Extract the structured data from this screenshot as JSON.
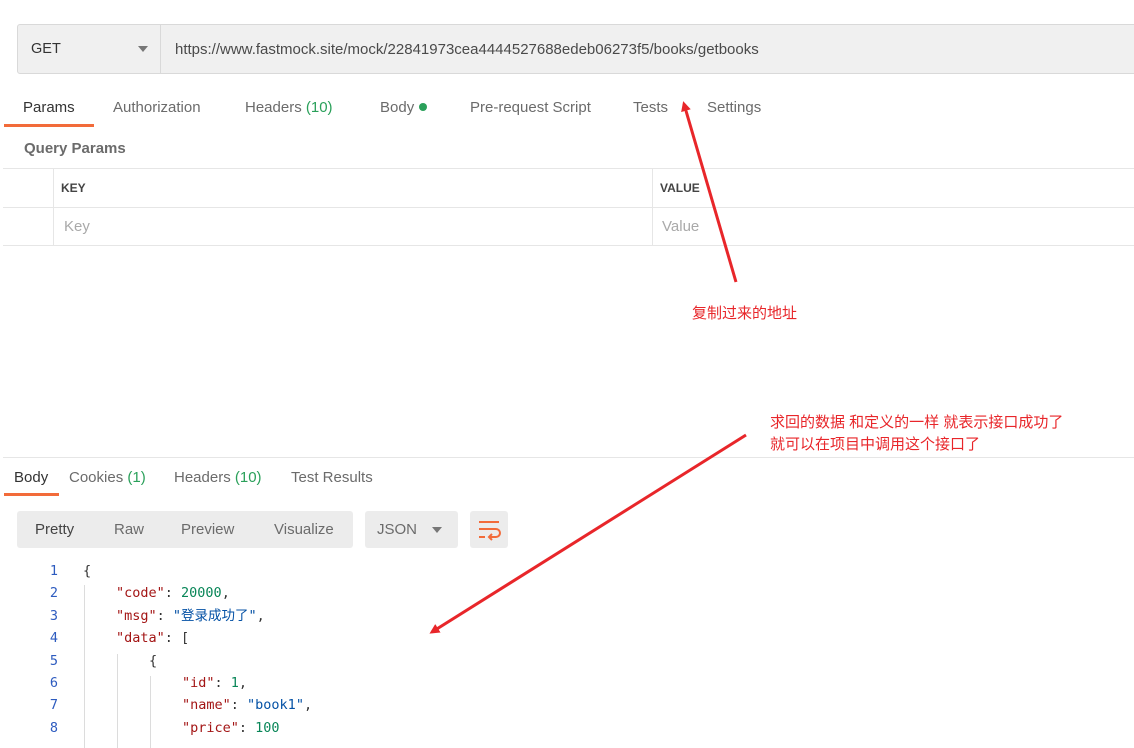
{
  "request": {
    "method": "GET",
    "url": "https://www.fastmock.site/mock/22841973cea4444527688edeb06273f5/books/getbooks"
  },
  "request_tabs": [
    {
      "label": "Params",
      "count": ""
    },
    {
      "label": "Authorization",
      "count": ""
    },
    {
      "label": "Headers",
      "count": "(10)"
    },
    {
      "label": "Body",
      "count": ""
    },
    {
      "label": "Pre-request Script",
      "count": ""
    },
    {
      "label": "Tests",
      "count": ""
    },
    {
      "label": "Settings",
      "count": ""
    }
  ],
  "query_params": {
    "title": "Query Params",
    "columns": [
      "KEY",
      "VALUE"
    ],
    "key_placeholder": "Key",
    "value_placeholder": "Value"
  },
  "annotations": {
    "address_note": "复制过来的地址",
    "response_note_line1": "求回的数据  和定义的一样  就表示接口成功了",
    "response_note_line2": "就可以在项目中调用这个接口了"
  },
  "response_tabs": [
    {
      "label": "Body",
      "count": ""
    },
    {
      "label": "Cookies",
      "count": "(1)"
    },
    {
      "label": "Headers",
      "count": "(10)"
    },
    {
      "label": "Test Results",
      "count": ""
    }
  ],
  "view_modes": [
    "Pretty",
    "Raw",
    "Preview",
    "Visualize"
  ],
  "format_select": "JSON",
  "code_lines": [
    {
      "n": "1",
      "indent": 0,
      "parts": [
        {
          "t": "p",
          "v": "{"
        }
      ]
    },
    {
      "n": "2",
      "indent": 1,
      "parts": [
        {
          "t": "k",
          "v": "\"code\""
        },
        {
          "t": "p",
          "v": ": "
        },
        {
          "t": "n",
          "v": "20000"
        },
        {
          "t": "p",
          "v": ","
        }
      ]
    },
    {
      "n": "3",
      "indent": 1,
      "parts": [
        {
          "t": "k",
          "v": "\"msg\""
        },
        {
          "t": "p",
          "v": ": "
        },
        {
          "t": "s",
          "v": "\"登录成功了\""
        },
        {
          "t": "p",
          "v": ","
        }
      ]
    },
    {
      "n": "4",
      "indent": 1,
      "parts": [
        {
          "t": "k",
          "v": "\"data\""
        },
        {
          "t": "p",
          "v": ": ["
        }
      ]
    },
    {
      "n": "5",
      "indent": 2,
      "parts": [
        {
          "t": "p",
          "v": "{"
        }
      ]
    },
    {
      "n": "6",
      "indent": 3,
      "parts": [
        {
          "t": "k",
          "v": "\"id\""
        },
        {
          "t": "p",
          "v": ": "
        },
        {
          "t": "n",
          "v": "1"
        },
        {
          "t": "p",
          "v": ","
        }
      ]
    },
    {
      "n": "7",
      "indent": 3,
      "parts": [
        {
          "t": "k",
          "v": "\"name\""
        },
        {
          "t": "p",
          "v": ": "
        },
        {
          "t": "s",
          "v": "\"book1\""
        },
        {
          "t": "p",
          "v": ","
        }
      ]
    },
    {
      "n": "8",
      "indent": 3,
      "parts": [
        {
          "t": "k",
          "v": "\"price\""
        },
        {
          "t": "p",
          "v": ": "
        },
        {
          "t": "n",
          "v": "100"
        }
      ]
    }
  ],
  "colors": {
    "accent": "#f26b3a",
    "count_green": "#2aa05a",
    "annotation_red": "#e8262a",
    "json_key": "#a31515",
    "json_number": "#098658",
    "json_string": "#0451a5",
    "line_number": "#2d5bbf"
  },
  "icons": {
    "method_dropdown": "chevron-down-icon",
    "body_dot": "status-dot-icon",
    "wrap": "wrap-lines-icon",
    "arrow": "red-arrow-annotation"
  }
}
